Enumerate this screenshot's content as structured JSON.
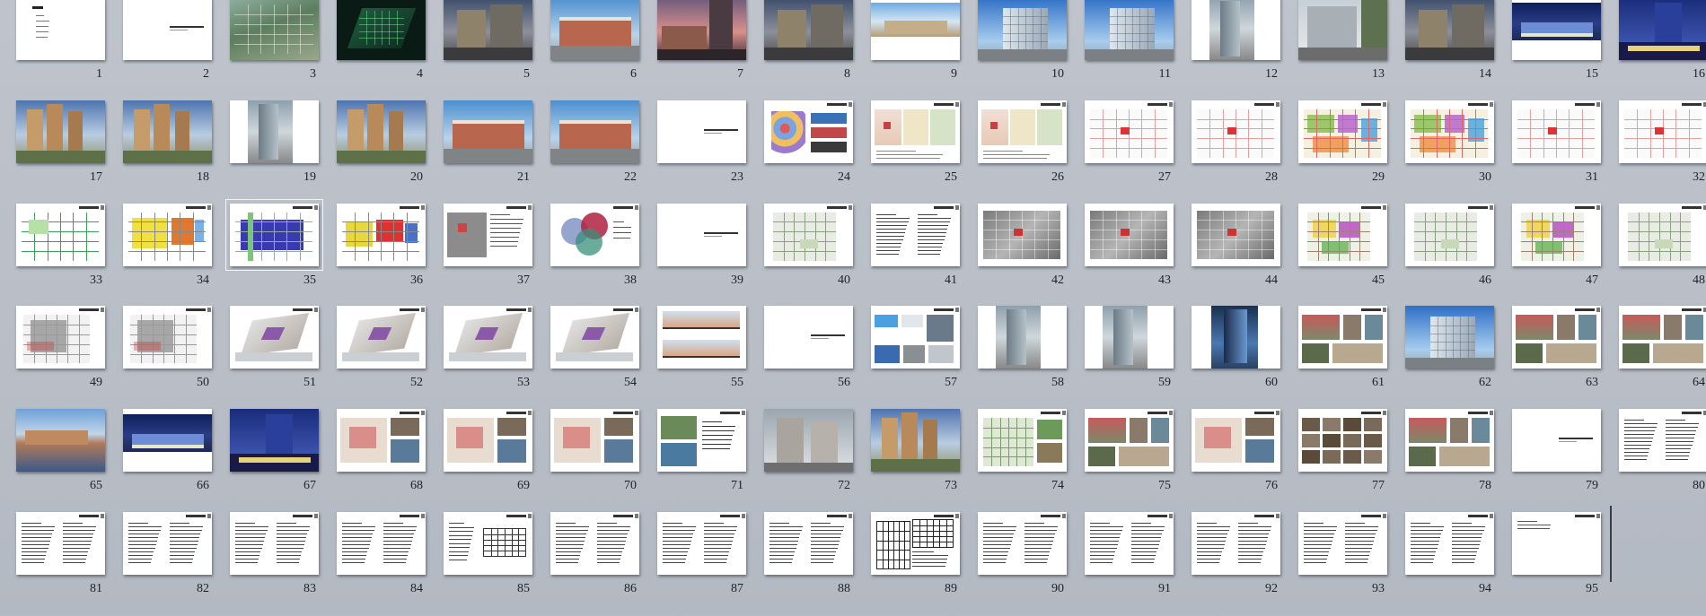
{
  "app": {
    "view": "slide-sorter",
    "accent": "#f3f4f6",
    "background": "#b7bcc4"
  },
  "slides": [
    {
      "number": "1",
      "kind": "title"
    },
    {
      "number": "2",
      "kind": "text-line"
    },
    {
      "number": "3",
      "kind": "aerial"
    },
    {
      "number": "4",
      "kind": "night-aerial"
    },
    {
      "number": "5",
      "kind": "building-dusk"
    },
    {
      "number": "6",
      "kind": "building-sky"
    },
    {
      "number": "7",
      "kind": "building-sunset"
    },
    {
      "number": "8",
      "kind": "building-dusk"
    },
    {
      "number": "9",
      "kind": "panorama"
    },
    {
      "number": "10",
      "kind": "office-sky"
    },
    {
      "number": "11",
      "kind": "office-sky"
    },
    {
      "number": "12",
      "kind": "tower-white"
    },
    {
      "number": "13",
      "kind": "street"
    },
    {
      "number": "14",
      "kind": "building-dusk"
    },
    {
      "number": "15",
      "kind": "night-panorama"
    },
    {
      "number": "16",
      "kind": "night-tower"
    },
    {
      "number": "17",
      "kind": "residential"
    },
    {
      "number": "18",
      "kind": "residential"
    },
    {
      "number": "19",
      "kind": "tower-white"
    },
    {
      "number": "20",
      "kind": "residential"
    },
    {
      "number": "21",
      "kind": "building-sky"
    },
    {
      "number": "22",
      "kind": "building-sky"
    },
    {
      "number": "23",
      "kind": "text-line"
    },
    {
      "number": "24",
      "kind": "map-colored"
    },
    {
      "number": "25",
      "kind": "plan-maps"
    },
    {
      "number": "26",
      "kind": "plan-maps"
    },
    {
      "number": "27",
      "kind": "plan-red"
    },
    {
      "number": "28",
      "kind": "plan-red"
    },
    {
      "number": "29",
      "kind": "plan-colored"
    },
    {
      "number": "30",
      "kind": "plan-colored"
    },
    {
      "number": "31",
      "kind": "plan-red"
    },
    {
      "number": "32",
      "kind": "plan-red"
    },
    {
      "number": "33",
      "kind": "plan-green"
    },
    {
      "number": "34",
      "kind": "plan-yellow"
    },
    {
      "number": "35",
      "kind": "plan-blue"
    },
    {
      "number": "36",
      "kind": "plan-red-blocks"
    },
    {
      "number": "37",
      "kind": "gray-map-text"
    },
    {
      "number": "38",
      "kind": "venn"
    },
    {
      "number": "39",
      "kind": "text-line"
    },
    {
      "number": "40",
      "kind": "site-plan"
    },
    {
      "number": "41",
      "kind": "text-columns"
    },
    {
      "number": "42",
      "kind": "gray-aerial"
    },
    {
      "number": "43",
      "kind": "gray-aerial"
    },
    {
      "number": "44",
      "kind": "gray-aerial"
    },
    {
      "number": "45",
      "kind": "site-plan-colored"
    },
    {
      "number": "46",
      "kind": "site-plan"
    },
    {
      "number": "47",
      "kind": "site-plan-colored"
    },
    {
      "number": "48",
      "kind": "site-plan"
    },
    {
      "number": "49",
      "kind": "site-plan-gray"
    },
    {
      "number": "50",
      "kind": "site-plan-gray"
    },
    {
      "number": "51",
      "kind": "model-3d"
    },
    {
      "number": "52",
      "kind": "model-3d"
    },
    {
      "number": "53",
      "kind": "model-3d"
    },
    {
      "number": "54",
      "kind": "model-3d"
    },
    {
      "number": "55",
      "kind": "elevations"
    },
    {
      "number": "56",
      "kind": "text-line"
    },
    {
      "number": "57",
      "kind": "collage-blue"
    },
    {
      "number": "58",
      "kind": "tower-white"
    },
    {
      "number": "59",
      "kind": "tower-white"
    },
    {
      "number": "60",
      "kind": "tower-blue"
    },
    {
      "number": "61",
      "kind": "collage"
    },
    {
      "number": "62",
      "kind": "office-sky"
    },
    {
      "number": "63",
      "kind": "collage"
    },
    {
      "number": "64",
      "kind": "collage"
    },
    {
      "number": "65",
      "kind": "waterfront"
    },
    {
      "number": "66",
      "kind": "night-panorama"
    },
    {
      "number": "67",
      "kind": "night-tower"
    },
    {
      "number": "68",
      "kind": "collage-plan"
    },
    {
      "number": "69",
      "kind": "collage-plan"
    },
    {
      "number": "70",
      "kind": "collage-plan"
    },
    {
      "number": "71",
      "kind": "collage-text"
    },
    {
      "number": "72",
      "kind": "residential-gray"
    },
    {
      "number": "73",
      "kind": "residential"
    },
    {
      "number": "74",
      "kind": "site-plan-green"
    },
    {
      "number": "75",
      "kind": "collage"
    },
    {
      "number": "76",
      "kind": "collage-plan"
    },
    {
      "number": "77",
      "kind": "photo-grid"
    },
    {
      "number": "78",
      "kind": "collage"
    },
    {
      "number": "79",
      "kind": "text-line"
    },
    {
      "number": "80",
      "kind": "text-columns"
    },
    {
      "number": "81",
      "kind": "text-columns"
    },
    {
      "number": "82",
      "kind": "text-columns"
    },
    {
      "number": "83",
      "kind": "text-columns"
    },
    {
      "number": "84",
      "kind": "text-columns"
    },
    {
      "number": "85",
      "kind": "text-table"
    },
    {
      "number": "86",
      "kind": "text-columns"
    },
    {
      "number": "87",
      "kind": "text-columns"
    },
    {
      "number": "88",
      "kind": "text-columns"
    },
    {
      "number": "89",
      "kind": "tables"
    },
    {
      "number": "90",
      "kind": "text-columns"
    },
    {
      "number": "91",
      "kind": "text-columns"
    },
    {
      "number": "92",
      "kind": "text-columns"
    },
    {
      "number": "93",
      "kind": "text-columns"
    },
    {
      "number": "94",
      "kind": "text-columns"
    },
    {
      "number": "95",
      "kind": "text-sparse"
    }
  ]
}
